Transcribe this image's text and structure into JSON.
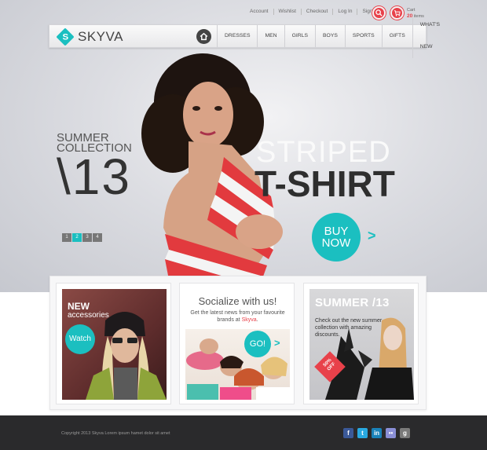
{
  "top_links": [
    "Account",
    "Wishlist",
    "Checkout",
    "Log In",
    "Sign Up"
  ],
  "cart": {
    "label": "Cart",
    "count": "20",
    "unit": "items"
  },
  "brand": {
    "name": "SKYVA"
  },
  "nav": {
    "items": [
      "DRESSES",
      "MEN",
      "GIRLS",
      "BOYS",
      "SPORTS",
      "GIFTS",
      "WHAT'S NEW"
    ]
  },
  "hero": {
    "line1": "SUMMER",
    "line2": "COLLECTION",
    "year": "\\13",
    "title_light": "STRIPED",
    "title_bold": "T-SHIRT",
    "cta_line1": "BUY",
    "cta_line2": "NOW",
    "cta_arrow": ">",
    "slides": [
      "1",
      "2",
      "3",
      "4"
    ],
    "active_slide": 2
  },
  "cards": {
    "accessories": {
      "title": "NEW",
      "subtitle": "accessories",
      "button": "Watch"
    },
    "social": {
      "title": "Socialize with us!",
      "text_before": "Get the latest news from your favourite brands at ",
      "brand": "Skyva",
      "text_after": ".",
      "button": "GO!",
      "arrow": ">"
    },
    "summer": {
      "title": "SUMMER /13",
      "text": "Check out the new summer collection with amazing discounts.",
      "badge_line1": "50%",
      "badge_line2": "OFF"
    }
  },
  "footer": {
    "copyright": "Copyright 2013 Skyva Lorem ipsum hamet dolor sit amet",
    "social_icons": [
      {
        "name": "facebook-icon",
        "glyph": "f",
        "color": "#3b5998"
      },
      {
        "name": "twitter-icon",
        "glyph": "t",
        "color": "#29a9e1"
      },
      {
        "name": "linkedin-icon",
        "glyph": "in",
        "color": "#1a82b9"
      },
      {
        "name": "flickr-icon",
        "glyph": "••",
        "color": "#8a8fd6"
      },
      {
        "name": "google-icon",
        "glyph": "g",
        "color": "#7a7a7a"
      }
    ]
  },
  "colors": {
    "accent": "#1bbfc0",
    "highlight": "#e8414a",
    "footer": "#2a2a2c"
  }
}
